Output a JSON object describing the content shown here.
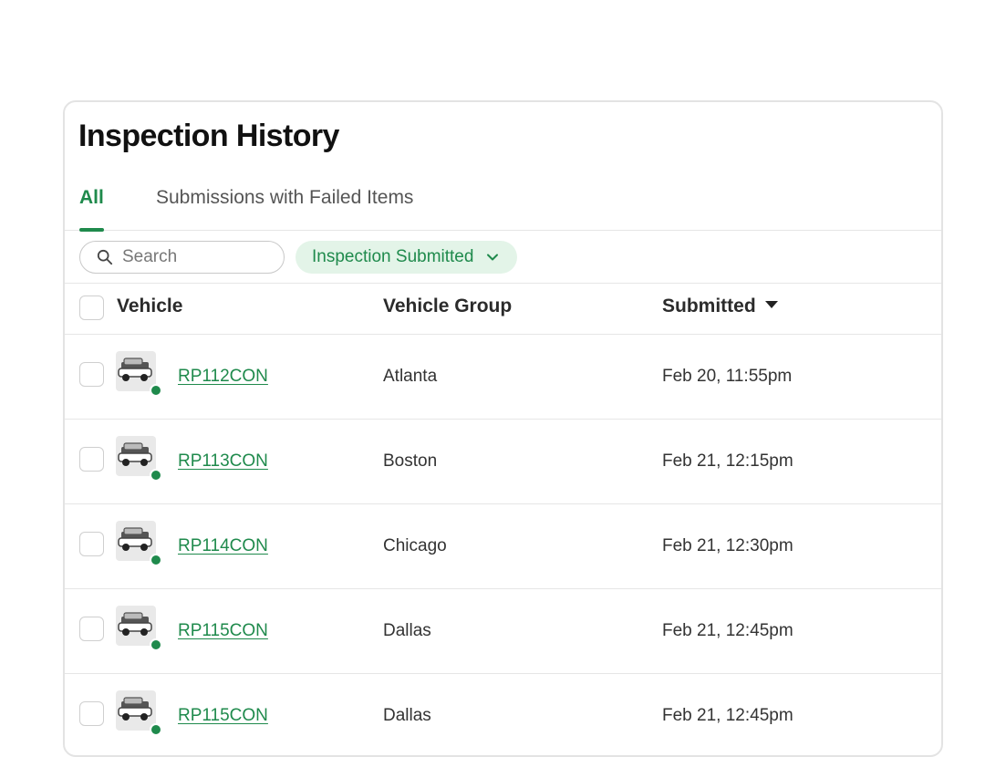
{
  "title": "Inspection History",
  "tabs": [
    {
      "label": "All",
      "active": true
    },
    {
      "label": "Submissions with Failed Items",
      "active": false
    }
  ],
  "search": {
    "placeholder": "Search",
    "value": ""
  },
  "filter_chip": {
    "label": "Inspection Submitted",
    "icon": "chevron-down-icon"
  },
  "columns": {
    "vehicle": "Vehicle",
    "group": "Vehicle Group",
    "submitted": "Submitted",
    "sort": "descending"
  },
  "rows": [
    {
      "vehicle": "RP112CON",
      "group": "Atlanta",
      "submitted": "Feb 20, 11:55pm",
      "thumb": "suv-icon",
      "status_color": "#1f8a4c"
    },
    {
      "vehicle": "RP113CON",
      "group": "Boston",
      "submitted": "Feb 21, 12:15pm",
      "thumb": "sedan-icon",
      "status_color": "#1f8a4c"
    },
    {
      "vehicle": "RP114CON",
      "group": "Chicago",
      "submitted": "Feb 21, 12:30pm",
      "thumb": "van-icon",
      "status_color": "#1f8a4c"
    },
    {
      "vehicle": "RP115CON",
      "group": "Dallas",
      "submitted": "Feb 21, 12:45pm",
      "thumb": "suv-icon",
      "status_color": "#1f8a4c"
    },
    {
      "vehicle": "RP115CON",
      "group": "Dallas",
      "submitted": "Feb 21, 12:45pm",
      "thumb": "suv-icon",
      "status_color": "#1f8a4c"
    }
  ],
  "colors": {
    "accent": "#1f8a4c",
    "chip_bg": "#e3f4e8",
    "border": "#e3e3e3"
  }
}
